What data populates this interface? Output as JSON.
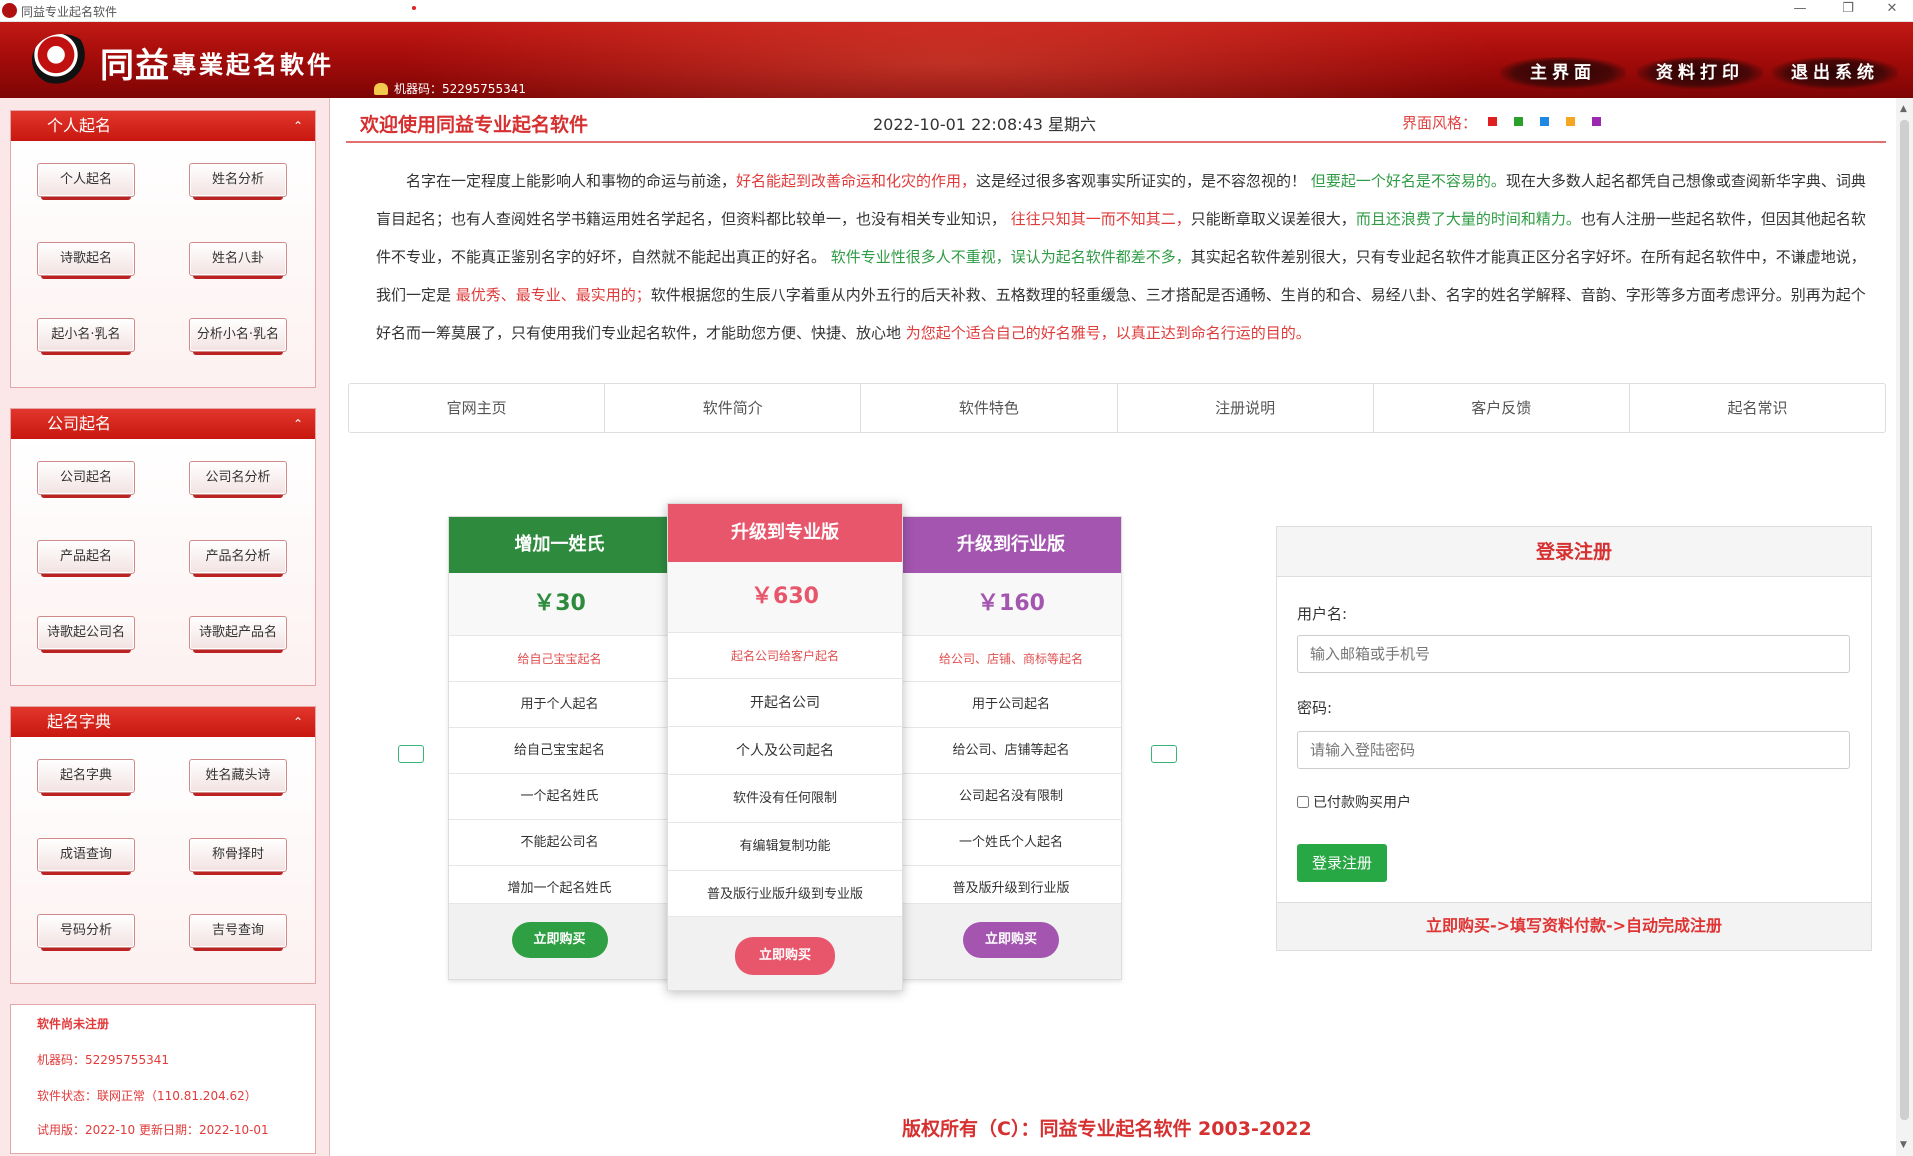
{
  "window": {
    "title": "同益专业起名软件",
    "controls": [
      "—",
      "❐",
      "✕"
    ]
  },
  "header": {
    "brand_name": "同益",
    "brand_sub": "專業起名軟件",
    "machine_code": "机器码：52295755341",
    "nav": [
      "主界面",
      "资料打印",
      "退出系统"
    ]
  },
  "sidebar": {
    "panels": [
      {
        "title": "个人起名",
        "chevron": "⌃",
        "buttons": [
          "个人起名",
          "姓名分析",
          "诗歌起名",
          "姓名八卦",
          "起小名·乳名",
          "分析小名·乳名"
        ]
      },
      {
        "title": "公司起名",
        "chevron": "⌃",
        "buttons": [
          "公司起名",
          "公司名分析",
          "产品起名",
          "产品名分析",
          "诗歌起公司名",
          "诗歌起产品名"
        ]
      },
      {
        "title": "起名字典",
        "chevron": "⌃",
        "buttons": [
          "起名字典",
          "姓名藏头诗",
          "成语查询",
          "称骨择时",
          "号码分析",
          "吉号查询"
        ]
      }
    ],
    "status": {
      "line1": "软件尚未注册",
      "line2": "机器码：52295755341",
      "line3": "软件状态：联网正常（110.81.204.62）",
      "line4": "试用版：2022-10    更新日期：2022-10-01"
    }
  },
  "main": {
    "welcome": "欢迎使用同益专业起名软件",
    "datetime": "2022-10-01 22:08:43 星期六",
    "style_label": "界面风格：",
    "style_colors": [
      "#e02020",
      "#2ba02b",
      "#1e88e5",
      "#f5a623",
      "#9c27b0"
    ],
    "intro": [
      {
        "t": "名字在一定程度上能影响人和事物的命运与前途，",
        "c": ""
      },
      {
        "t": "好名能起到改善命运和化灾的作用，",
        "c": "r"
      },
      {
        "t": "这是经过很多客观事实所证实的，是不容忽视的！ ",
        "c": ""
      },
      {
        "t": "但要起一个好名是不容易的。",
        "c": "g"
      },
      {
        "t": "现在大多数人起名都凭自己想像或查阅新华字典、词典盲目起名；也有人查阅姓名学书籍运用姓名学起名，但资料都比较单一，也没有相关专业知识， ",
        "c": ""
      },
      {
        "t": "往往只知其一而不知其二，",
        "c": "r"
      },
      {
        "t": "只能断章取义误差很大，",
        "c": ""
      },
      {
        "t": "而且还浪费了大量的时间和精力。",
        "c": "g"
      },
      {
        "t": "也有人注册一些起名软件，但因其他起名软件不专业，不能真正鉴别名字的好坏，自然就不能起出真正的好名。 ",
        "c": ""
      },
      {
        "t": "软件专业性很多人不重视，误认为起名软件都差不多，",
        "c": "g"
      },
      {
        "t": "其实起名软件差别很大，只有专业起名软件才能真正区分名字好坏。在所有起名软件中，不谦虚地说，我们一定是 ",
        "c": ""
      },
      {
        "t": "最优秀、最专业、最实用的；",
        "c": "r"
      },
      {
        "t": "软件根据您的生辰八字着重从内外五行的后天补救、五格数理的轻重缓急、三才搭配是否通畅、生肖的和合、易经八卦、名字的姓名学解释、音韵、字形等多方面考虑评分。别再为起个好名而一筹莫展了，只有使用我们专业起名软件，才能助您方便、快捷、放心地 ",
        "c": ""
      },
      {
        "t": "为您起个适合自己的好名雅号，以真正达到命名行运的目的。",
        "c": "r"
      }
    ],
    "tabs": [
      "官网主页",
      "软件简介",
      "软件特色",
      "注册说明",
      "客户反馈",
      "起名常识"
    ],
    "cards": [
      {
        "title": "增加一姓氏",
        "price": "￥30",
        "subtitle": "给自己宝宝起名",
        "features": [
          "用于个人起名",
          "给自己宝宝起名",
          "一个起名姓氏",
          "不能起公司名",
          "增加一个起名姓氏"
        ],
        "button": "立即购买",
        "color": "#2e8b3e"
      },
      {
        "title": "升级到专业版",
        "price": "￥630",
        "subtitle": "起名公司给客户起名",
        "features": [
          "开起名公司",
          "个人及公司起名",
          "软件没有任何限制",
          "有编辑复制功能",
          "普及版行业版升级到专业版"
        ],
        "button": "立即购买",
        "color": "#e8566c"
      },
      {
        "title": "升级到行业版",
        "price": "￥160",
        "subtitle": "给公司、店铺、商标等起名",
        "features": [
          "用于公司起名",
          "给公司、店铺等起名",
          "公司起名没有限制",
          "一个姓氏个人起名",
          "普及版升级到行业版"
        ],
        "button": "立即购买",
        "color": "#a355b0"
      }
    ],
    "login": {
      "title": "登录注册",
      "username_label": "用户名:",
      "username_placeholder": "输入邮箱或手机号",
      "password_label": "密码:",
      "password_placeholder": "请输入登陆密码",
      "paid_label": "已付款购买用户",
      "submit": "登录注册",
      "footer": "立即购买->填写资料付款->自动完成注册"
    },
    "copyright": "版权所有（C）：同益专业起名软件 2003-2022"
  }
}
